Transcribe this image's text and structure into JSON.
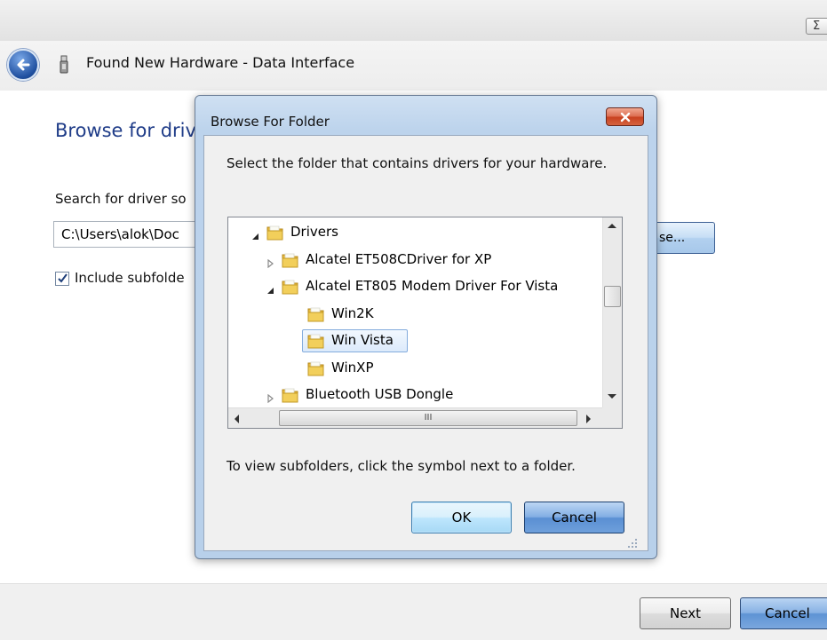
{
  "window": {
    "title": "Found New Hardware - Data Interface",
    "close_glyph": "Σ"
  },
  "wizard": {
    "heading": "Browse for driv",
    "search_label": "Search for driver so",
    "path_value": "C:\\Users\\alok\\Doc",
    "browse_label": "se...",
    "include_subfolders_label": "Include subfolde",
    "include_subfolders_checked": true,
    "next_label": "Next",
    "cancel_label": "Cancel"
  },
  "dialog": {
    "title": "Browse For Folder",
    "instruction": "Select the folder that contains drivers for your hardware.",
    "hint": "To view subfolders, click the symbol next to a folder.",
    "ok_label": "OK",
    "cancel_label": "Cancel",
    "tree": [
      {
        "label": "Drivers",
        "depth": 0,
        "expander": "expanded",
        "selected": false
      },
      {
        "label": "Alcatel ET508CDriver for XP",
        "depth": 1,
        "expander": "collapsed",
        "selected": false
      },
      {
        "label": "Alcatel ET805 Modem Driver For Vista",
        "depth": 1,
        "expander": "expanded",
        "selected": false
      },
      {
        "label": "Win2K",
        "depth": 2,
        "expander": "none",
        "selected": false
      },
      {
        "label": "Win Vista",
        "depth": 2,
        "expander": "none",
        "selected": true
      },
      {
        "label": "WinXP",
        "depth": 2,
        "expander": "none",
        "selected": false
      },
      {
        "label": "Bluetooth USB Dongle",
        "depth": 1,
        "expander": "collapsed",
        "selected": false
      }
    ],
    "hscroll_thumb_glyph": "III"
  },
  "colors": {
    "heading_blue": "#1f3c88",
    "selection_border": "#84acdd",
    "folder_yellow": "#f2cf5b"
  },
  "icons": [
    "back-arrow-icon",
    "usb-device-icon",
    "close-icon",
    "folder-icon",
    "expand-arrow-icon",
    "collapse-arrow-icon",
    "resize-grip-icon"
  ]
}
